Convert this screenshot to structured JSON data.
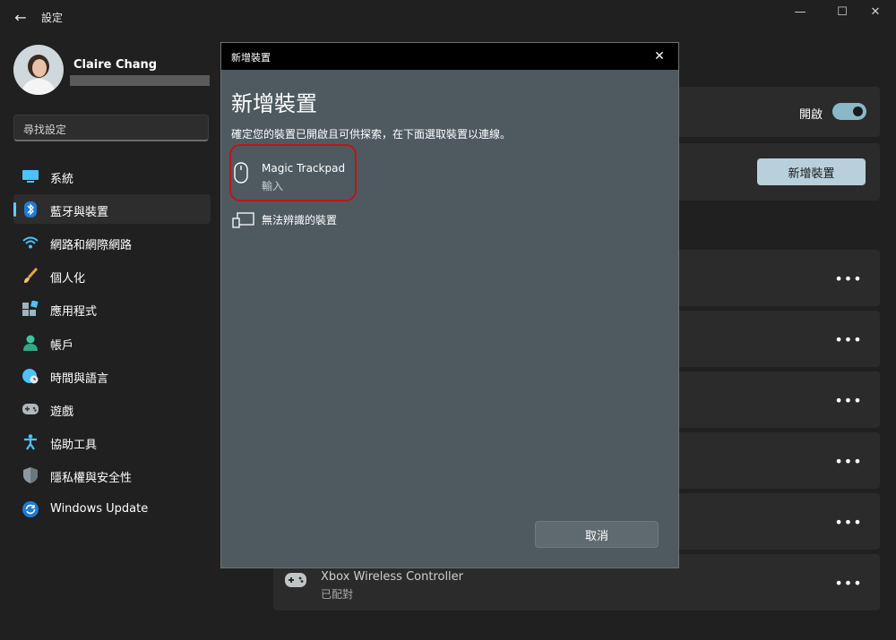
{
  "window": {
    "title": "設定",
    "back_icon": "←",
    "minimize_icon": "—",
    "maximize_icon": "☐",
    "close_icon": "✕"
  },
  "profile": {
    "name": "Claire Chang"
  },
  "search": {
    "placeholder": "尋找設定"
  },
  "sidebar": {
    "items": [
      {
        "label": "系統",
        "icon": "monitor-icon"
      },
      {
        "label": "藍牙與裝置",
        "icon": "bluetooth-icon",
        "active": true
      },
      {
        "label": "網路和網際網路",
        "icon": "wifi-icon"
      },
      {
        "label": "個人化",
        "icon": "brush-icon"
      },
      {
        "label": "應用程式",
        "icon": "apps-icon"
      },
      {
        "label": "帳戶",
        "icon": "person-icon"
      },
      {
        "label": "時間與語言",
        "icon": "globe-clock-icon"
      },
      {
        "label": "遊戲",
        "icon": "gamepad-icon"
      },
      {
        "label": "協助工具",
        "icon": "accessibility-icon"
      },
      {
        "label": "隱私權與安全性",
        "icon": "shield-icon"
      },
      {
        "label": "Windows Update",
        "icon": "update-icon"
      }
    ]
  },
  "main": {
    "bluetooth_toggle_label": "開啟",
    "bluetooth_on": true,
    "add_device_label": "新增裝置",
    "more_icon": "•••",
    "xbox": {
      "name": "Xbox Wireless Controller",
      "status": "已配對"
    }
  },
  "dialog": {
    "window_title": "新增裝置",
    "close_icon": "✕",
    "heading": "新增裝置",
    "instruction": "確定您的裝置已開啟且可供探索，在下面選取裝置以連線。",
    "devices": [
      {
        "name": "Magic Trackpad",
        "type": "輸入",
        "icon": "mouse-icon"
      },
      {
        "name": "無法辨識的裝置",
        "type": "",
        "icon": "unknown-device-icon"
      }
    ],
    "cancel_label": "取消"
  },
  "colors": {
    "accent": "#60cdff",
    "toggle_on": "#8bb8c8",
    "highlight": "#c0141c",
    "dialog_bg": "#4e5a60"
  }
}
